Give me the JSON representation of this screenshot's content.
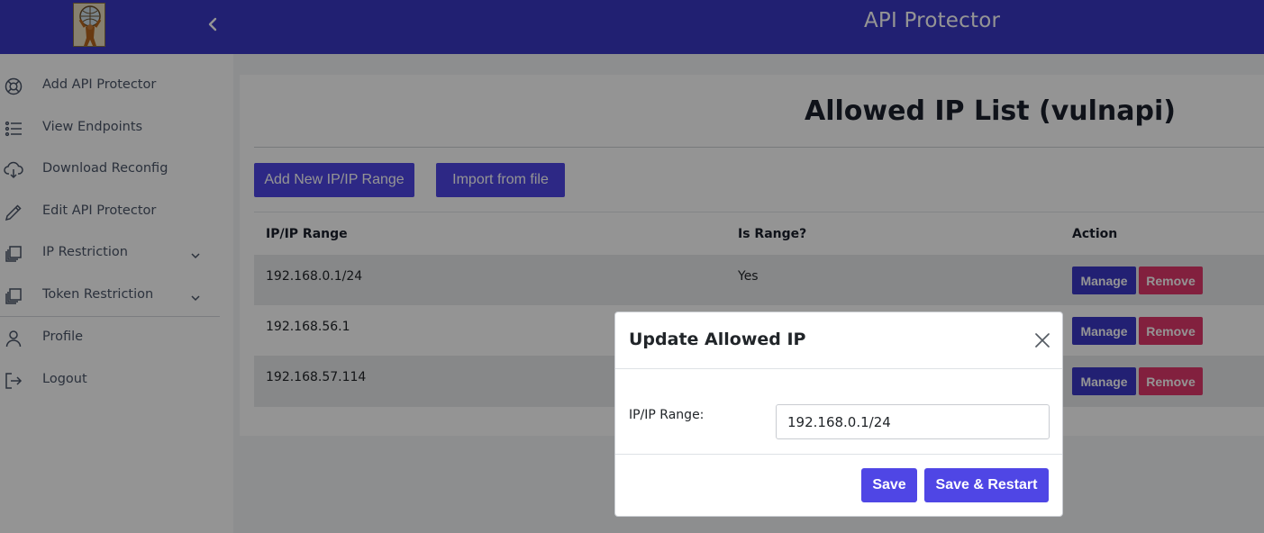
{
  "header": {
    "app_title": "API Protector",
    "background_color": "#3a37c4",
    "logo_icon": "atlas-logo-icon",
    "collapse_icon": "chevron-left-icon"
  },
  "sidebar": {
    "items": [
      {
        "label": "Add API Protector",
        "icon": "lifebuoy-icon"
      },
      {
        "label": "View Endpoints",
        "icon": "list-icon"
      },
      {
        "label": "Download Reconfig",
        "icon": "cloud-download-icon"
      },
      {
        "label": "Edit API Protector",
        "icon": "pencil-icon"
      },
      {
        "label": "IP Restriction",
        "icon": "stack-icon",
        "expandable": true
      },
      {
        "label": "Token Restriction",
        "icon": "stack-icon",
        "expandable": true
      },
      {
        "label": "Profile",
        "icon": "person-icon"
      },
      {
        "label": "Logout",
        "icon": "logout-icon"
      }
    ]
  },
  "main": {
    "page_title": "Allowed IP List (vulnapi)",
    "add_button": "Add New IP/IP Range",
    "import_button": "Import from file",
    "table": {
      "headers": [
        "IP/IP Range",
        "Is Range?",
        "Action"
      ],
      "rows": [
        {
          "ip": "192.168.0.1/24",
          "is_range": "Yes"
        },
        {
          "ip": "192.168.56.1",
          "is_range": ""
        },
        {
          "ip": "192.168.57.114",
          "is_range": ""
        }
      ],
      "manage_label": "Manage",
      "remove_label": "Remove"
    }
  },
  "modal": {
    "title": "Update Allowed IP",
    "field_label": "IP/IP Range:",
    "field_value": "192.168.0.1/24",
    "save_label": "Save",
    "save_restart_label": "Save & Restart"
  },
  "colors": {
    "primary": "#4f46e5",
    "manage": "#3b38c6",
    "remove": "#e0386c"
  }
}
